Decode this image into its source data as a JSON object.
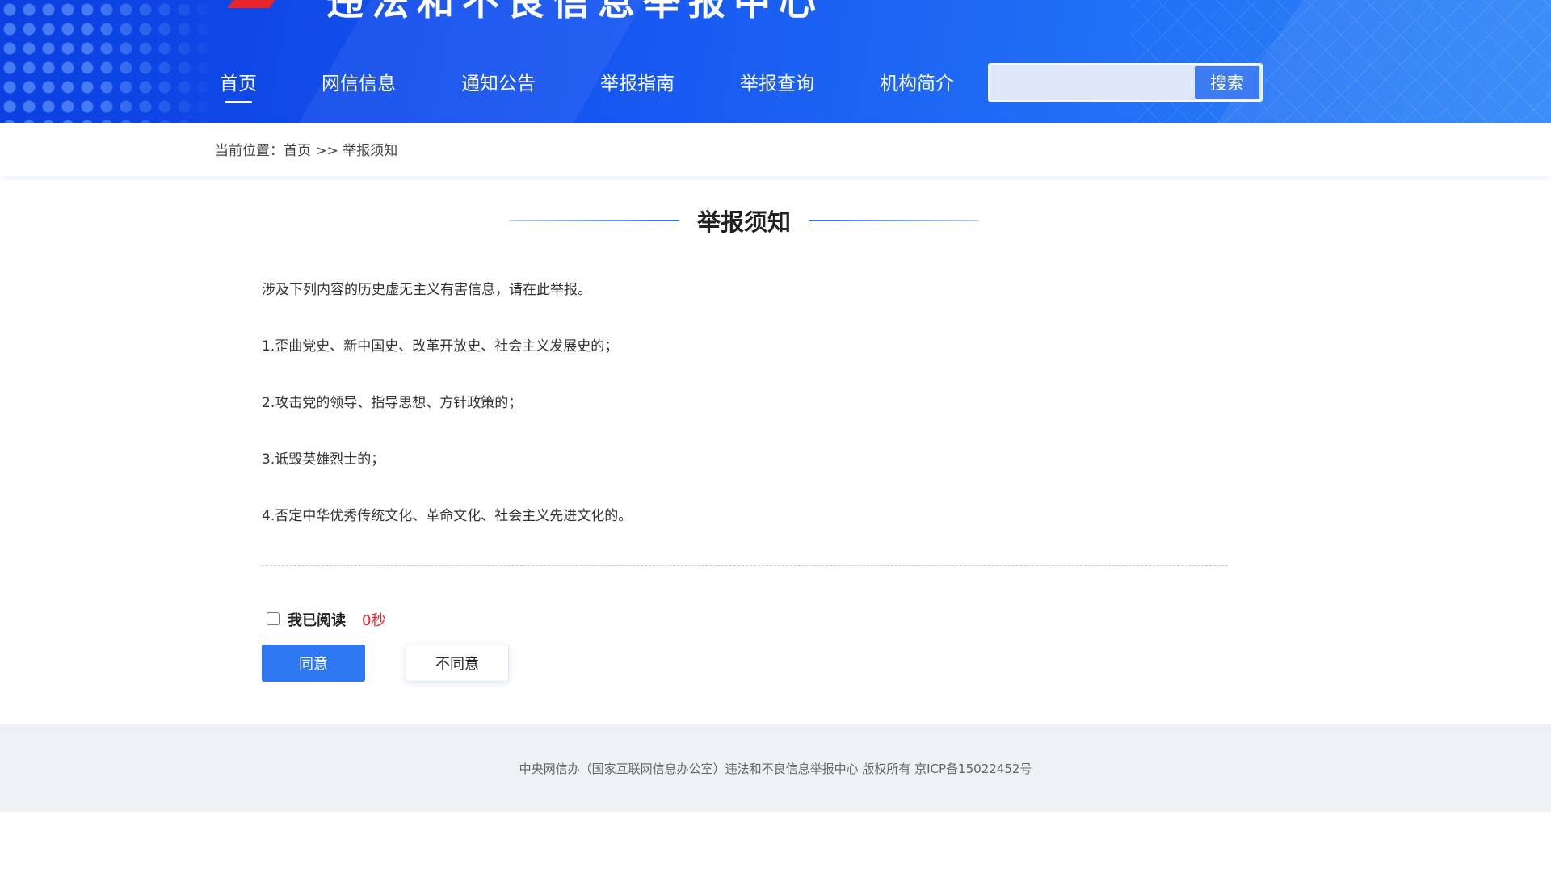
{
  "header": {
    "site_title": "违法和不良信息举报中心",
    "nav": [
      {
        "label": "首页",
        "active": true
      },
      {
        "label": "网信信息",
        "active": false
      },
      {
        "label": "通知公告",
        "active": false
      },
      {
        "label": "举报指南",
        "active": false
      },
      {
        "label": "举报查询",
        "active": false
      },
      {
        "label": "机构简介",
        "active": false
      }
    ],
    "search": {
      "value": "",
      "button_label": "搜索"
    }
  },
  "breadcrumb": {
    "text": "当前位置：首页 >> 举报须知"
  },
  "main": {
    "title": "举报须知",
    "paragraphs": [
      "涉及下列内容的历史虚无主义有害信息，请在此举报。",
      "1.歪曲党史、新中国史、改革开放史、社会主义发展史的；",
      "2.攻击党的领导、指导思想、方针政策的；",
      "3.诋毁英雄烈士的；",
      "4.否定中华优秀传统文化、革命文化、社会主义先进文化的。"
    ],
    "read_label": "我已阅读",
    "countdown": "0秒",
    "read_checked": false,
    "agree_label": "同意",
    "disagree_label": "不同意"
  },
  "footer": {
    "text": "中央网信办（国家互联网信息办公室）违法和不良信息举报中心 版权所有 京ICP备15022452号"
  },
  "colors": {
    "accent": "#2e78f3",
    "header_start": "#0b3fe0",
    "countdown_red": "#e8252b",
    "footer_bg": "#eef0f3"
  },
  "icons": {
    "logo": "red-slash-logo-icon"
  }
}
